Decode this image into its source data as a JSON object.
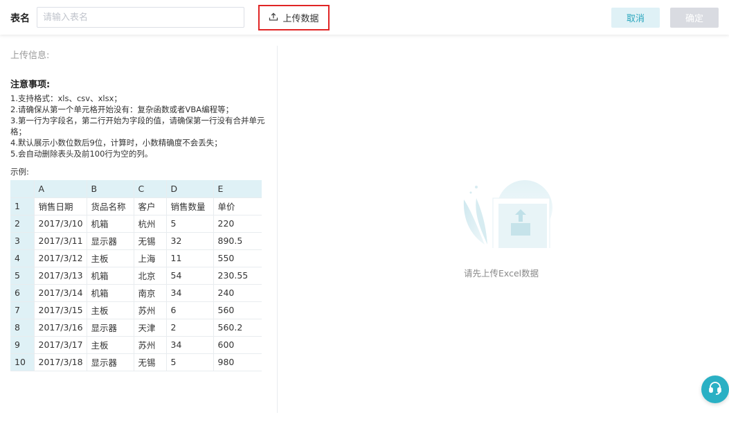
{
  "header": {
    "table_name_label": "表名",
    "table_name_placeholder": "请输入表名",
    "table_name_value": "",
    "upload_label": "上传数据",
    "cancel_label": "取消",
    "confirm_label": "确定"
  },
  "left": {
    "upload_info": "上传信息:",
    "notes_title": "注意事项:",
    "notes": [
      "1.支持格式：xls、csv、xlsx；",
      "2.请确保从第一个单元格开始没有：复杂函数或者VBA编程等；",
      "3.第一行为字段名，第二行开始为字段的值，请确保第一行没有合并单元格；",
      "4.默认展示小数位数后9位，计算时，小数精确度不会丢失；",
      "5.会自动删除表头及前100行为空的列。"
    ],
    "example_label": "示例:",
    "sample_table": {
      "columns": [
        "A",
        "B",
        "C",
        "D",
        "E"
      ],
      "rows": [
        {
          "num": "1",
          "cells": [
            "销售日期",
            "货品名称",
            "客户",
            "销售数量",
            "单价"
          ]
        },
        {
          "num": "2",
          "cells": [
            "2017/3/10",
            "机箱",
            "杭州",
            "5",
            "220"
          ]
        },
        {
          "num": "3",
          "cells": [
            "2017/3/11",
            "显示器",
            "无锡",
            "32",
            "890.5"
          ]
        },
        {
          "num": "4",
          "cells": [
            "2017/3/12",
            "主板",
            "上海",
            "11",
            "550"
          ]
        },
        {
          "num": "5",
          "cells": [
            "2017/3/13",
            "机箱",
            "北京",
            "54",
            "230.55"
          ]
        },
        {
          "num": "6",
          "cells": [
            "2017/3/14",
            "机箱",
            "南京",
            "34",
            "240"
          ]
        },
        {
          "num": "7",
          "cells": [
            "2017/3/15",
            "主板",
            "苏州",
            "6",
            "560"
          ]
        },
        {
          "num": "8",
          "cells": [
            "2017/3/16",
            "显示器",
            "天津",
            "2",
            "560.2"
          ]
        },
        {
          "num": "9",
          "cells": [
            "2017/3/17",
            "主板",
            "苏州",
            "34",
            "600"
          ]
        },
        {
          "num": "10",
          "cells": [
            "2017/3/18",
            "显示器",
            "无锡",
            "5",
            "980"
          ]
        }
      ]
    }
  },
  "right": {
    "empty_text": "请先上传Excel数据"
  },
  "colors": {
    "accent": "#2aa6bd",
    "highlight_border": "#e02424",
    "table_header_bg": "#dff1f6"
  },
  "icons": {
    "upload": "upload-icon",
    "empty_state": "excel-upload-illustration",
    "help": "customer-service-icon"
  }
}
